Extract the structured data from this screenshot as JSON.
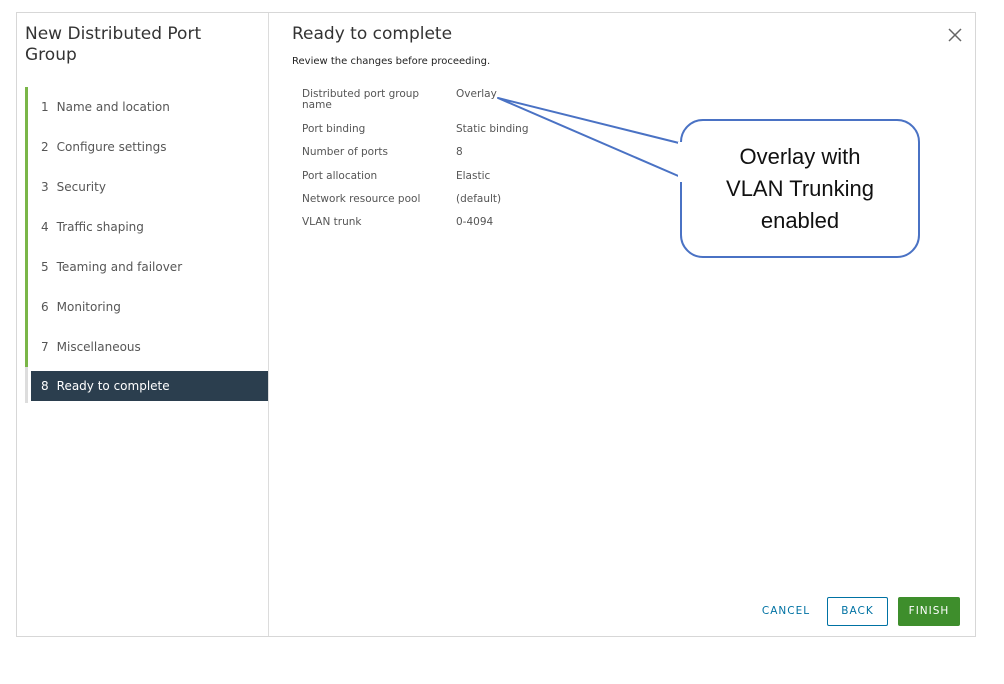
{
  "wizard": {
    "title": "New Distributed Port Group",
    "steps": [
      {
        "num": "1",
        "label": "Name and location"
      },
      {
        "num": "2",
        "label": "Configure settings"
      },
      {
        "num": "3",
        "label": "Security"
      },
      {
        "num": "4",
        "label": "Traffic shaping"
      },
      {
        "num": "5",
        "label": "Teaming and failover"
      },
      {
        "num": "6",
        "label": "Monitoring"
      },
      {
        "num": "7",
        "label": "Miscellaneous"
      },
      {
        "num": "8",
        "label": "Ready to complete"
      }
    ],
    "active_step": "8"
  },
  "main": {
    "title": "Ready to complete",
    "subtitle": "Review the changes before proceeding.",
    "summary": [
      {
        "key": "Distributed port group name",
        "value": "Overlay"
      },
      {
        "key": "Port binding",
        "value": "Static binding"
      },
      {
        "key": "Number of ports",
        "value": "8"
      },
      {
        "key": "Port allocation",
        "value": "Elastic"
      },
      {
        "key": "Network resource pool",
        "value": "(default)"
      },
      {
        "key": "VLAN trunk",
        "value": "0-4094"
      }
    ]
  },
  "footer": {
    "cancel_label": "CANCEL",
    "back_label": "BACK",
    "finish_label": "FINISH"
  },
  "callout": {
    "line1": "Overlay with",
    "line2": "VLAN Trunking",
    "line3": "enabled"
  },
  "icons": {
    "close": "close-icon"
  },
  "colors": {
    "active_step_bg": "#2b3e4e",
    "progress": "#7ab648",
    "link": "#0072a3",
    "finish_bg": "#3e8e2c",
    "callout_border": "#4a72c4"
  }
}
